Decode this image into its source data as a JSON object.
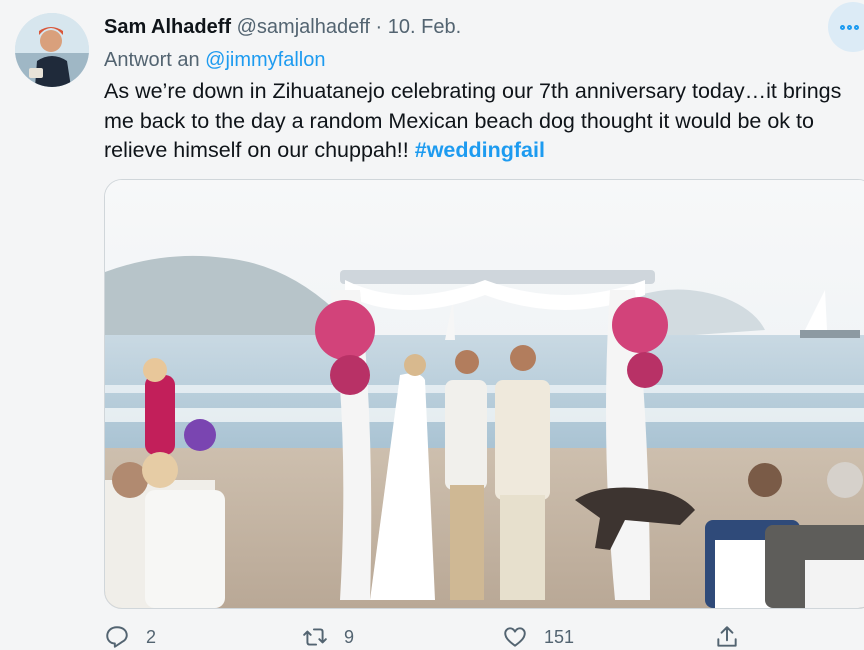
{
  "author": {
    "name": "Sam Alhadeff",
    "handle": "@samjalhadeff",
    "separator": "·",
    "date": "10. Feb."
  },
  "reply": {
    "prefix": "Antwort an",
    "mention": "@jimmyfallon"
  },
  "tweet": {
    "text": "As we’re down in Zihuatanejo celebrating our 7th anniversary today…it brings me back to the day a random Mexican beach dog thought it would be ok to relieve himself on our chuppah!! ",
    "hashtag": "#weddingfail"
  },
  "actions": {
    "reply_count": "2",
    "retweet_count": "9",
    "like_count": "151"
  },
  "icons": {
    "more": "more-icon",
    "reply": "reply-icon",
    "retweet": "retweet-icon",
    "like": "heart-icon",
    "share": "share-icon"
  },
  "colors": {
    "accent": "#1d9bf0",
    "secondary_text": "#536471",
    "background": "#f4f5f6"
  }
}
